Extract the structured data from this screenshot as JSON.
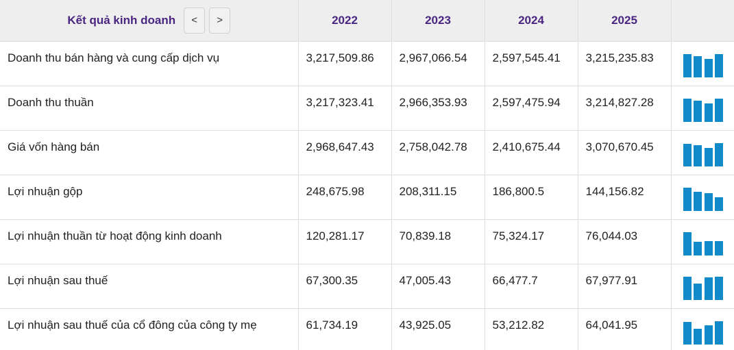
{
  "header": {
    "title": "Kết quả kinh doanh",
    "prev_label": "<",
    "next_label": ">",
    "years": [
      "2022",
      "2023",
      "2024",
      "2025"
    ]
  },
  "rows": [
    {
      "label": "Doanh thu bán hàng và cung cấp dịch vụ",
      "values": [
        "3,217,509.86",
        "2,967,066.54",
        "2,597,545.41",
        "3,215,235.83"
      ],
      "series": [
        3217509.86,
        2967066.54,
        2597545.41,
        3215235.83
      ]
    },
    {
      "label": "Doanh thu thuần",
      "values": [
        "3,217,323.41",
        "2,966,353.93",
        "2,597,475.94",
        "3,214,827.28"
      ],
      "series": [
        3217323.41,
        2966353.93,
        2597475.94,
        3214827.28
      ]
    },
    {
      "label": "Giá vốn hàng bán",
      "values": [
        "2,968,647.43",
        "2,758,042.78",
        "2,410,675.44",
        "3,070,670.45"
      ],
      "series": [
        2968647.43,
        2758042.78,
        2410675.44,
        3070670.45
      ]
    },
    {
      "label": "Lợi nhuận gộp",
      "values": [
        "248,675.98",
        "208,311.15",
        "186,800.5",
        "144,156.82"
      ],
      "series": [
        248675.98,
        208311.15,
        186800.5,
        144156.82
      ]
    },
    {
      "label": "Lợi nhuận thuần từ hoạt động kinh doanh",
      "values": [
        "120,281.17",
        "70,839.18",
        "75,324.17",
        "76,044.03"
      ],
      "series": [
        120281.17,
        70839.18,
        75324.17,
        76044.03
      ]
    },
    {
      "label": "Lợi nhuận sau thuế",
      "values": [
        "67,300.35",
        "47,005.43",
        "66,477.7",
        "67,977.91"
      ],
      "series": [
        67300.35,
        47005.43,
        66477.7,
        67977.91
      ]
    },
    {
      "label": "Lợi nhuận sau thuế của cổ đông của công ty mẹ",
      "values": [
        "61,734.19",
        "43,925.05",
        "53,212.82",
        "64,041.95"
      ],
      "series": [
        61734.19,
        43925.05,
        53212.82,
        64041.95
      ]
    }
  ],
  "colors": {
    "header_text": "#4a2582",
    "header_bg": "#eeeeee",
    "spark_bar": "#1289c8",
    "grid": "#dedede"
  }
}
